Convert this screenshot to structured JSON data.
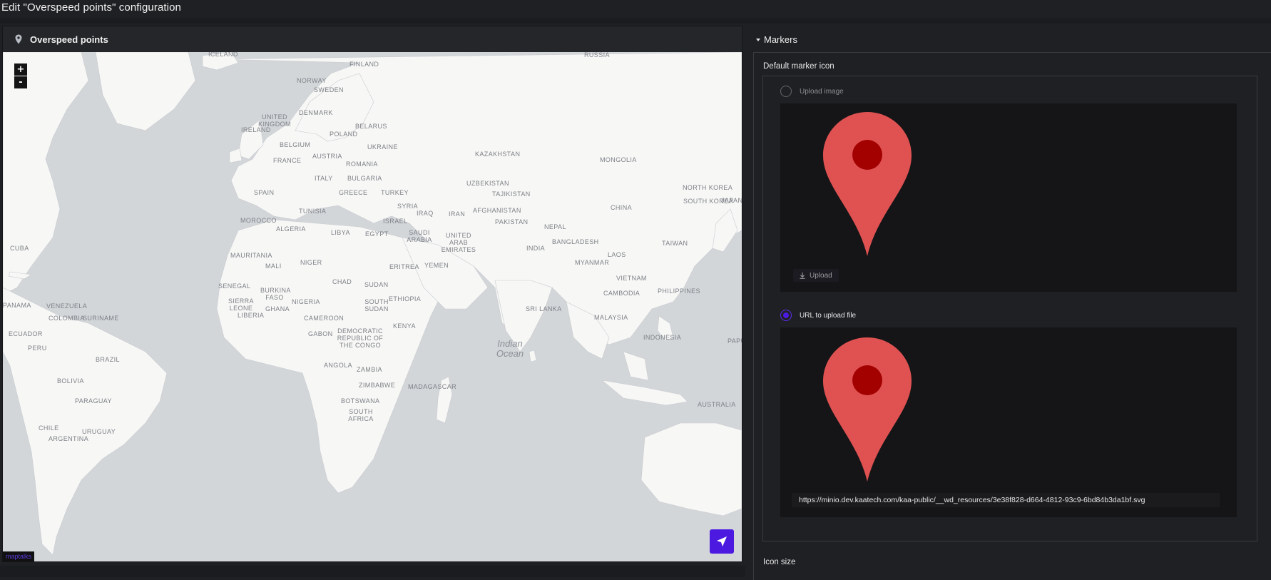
{
  "page": {
    "title": "Edit \"Overspeed points\" configuration"
  },
  "map_widget": {
    "title": "Overspeed points",
    "zoom_in": "+",
    "zoom_out": "-",
    "attribution": "maptalks",
    "country_labels": [
      "ICELAND",
      "FINLAND",
      "RUSSIA",
      "NORWAY",
      "SWEDEN",
      "DENMARK",
      "UNITED KINGDOM",
      "IRELAND",
      "POLAND",
      "BELARUS",
      "BELGIUM",
      "UKRAINE",
      "AUSTRIA",
      "KAZAKHSTAN",
      "FRANCE",
      "ROMANIA",
      "MONGOLIA",
      "ITALY",
      "BULGARIA",
      "UZBEKISTAN",
      "SPAIN",
      "GREECE",
      "TURKEY",
      "TAJIKISTAN",
      "NORTH KOREA",
      "SOUTH KOREA",
      "JAPAN",
      "TUNISIA",
      "SYRIA",
      "IRAQ",
      "IRAN",
      "AFGHANISTAN",
      "CHINA",
      "MOROCCO",
      "ISRAEL",
      "PAKISTAN",
      "ALGERIA",
      "LIBYA",
      "EGYPT",
      "SAUDI ARABIA",
      "UNITED ARAB EMIRATES",
      "NEPAL",
      "BANGLADESH",
      "TAIWAN",
      "INDIA",
      "CUBA",
      "MAURITANIA",
      "MALI",
      "NIGER",
      "ERITREA",
      "YEMEN",
      "MYANMAR",
      "LAOS",
      "SENEGAL",
      "CHAD",
      "SUDAN",
      "VIETNAM",
      "BURKINA FASO",
      "PHILIPPINES",
      "CAMBODIA",
      "NIGERIA",
      "ETHIOPIA",
      "PANAMA",
      "VENEZUELA",
      "SIERRA LEONE",
      "GHANA",
      "SOUTH SUDAN",
      "SRI LANKA",
      "LIBERIA",
      "COLOMBIA",
      "SURINAME",
      "CAMEROON",
      "MALAYSIA",
      "ECUADOR",
      "GABON",
      "KENYA",
      "INDONESIA",
      "DEMOCRATIC REPUBLIC OF THE CONGO",
      "PAPUA",
      "PERU",
      "BRAZIL",
      "ANGOLA",
      "ZAMBIA",
      "BOLIVIA",
      "ZIMBABWE",
      "MADAGASCAR",
      "PARAGUAY",
      "BOTSWANA",
      "AUSTRALIA",
      "SOUTH AFRICA",
      "CHILE",
      "URUGUAY",
      "ARGENTINA"
    ],
    "ocean_label": "Indian Ocean"
  },
  "markers": {
    "section_title": "Markers",
    "default_icon_label": "Default marker icon",
    "upload_image_label": "Upload image",
    "upload_button": "Upload",
    "url_option_label": "URL to upload file",
    "url_value": "https://minio.dev.kaatech.com/kaa-public/__wd_resources/3e38f828-d664-4812-93c9-6bd84b3da1bf.svg",
    "selected_option": "URL to upload file",
    "icon_size_label": "Icon size"
  },
  "colors": {
    "accent": "#4b19e0",
    "marker_red": "#e05252",
    "marker_dot": "#a30000",
    "background": "#1f2024"
  },
  "icons": [
    "map-pin-icon",
    "cursor-arrow-icon",
    "download-icon",
    "caret-down-icon"
  ]
}
